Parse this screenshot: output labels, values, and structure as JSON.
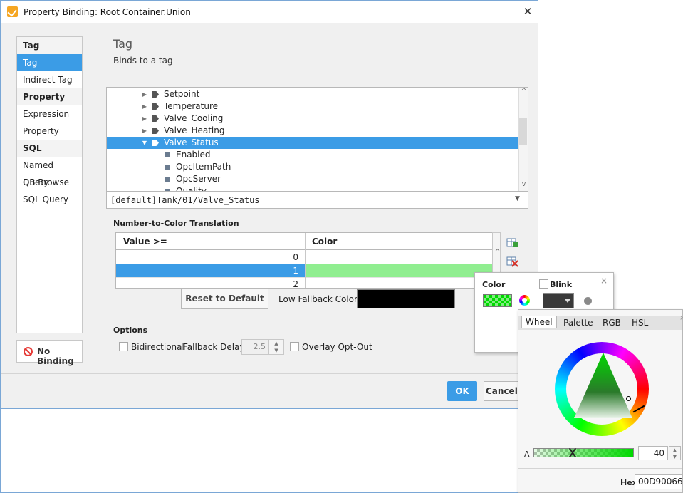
{
  "window": {
    "title": "Property Binding: Root Container.Union",
    "close": "✕"
  },
  "sidebar": {
    "items": [
      {
        "label": "Tag",
        "type": "header"
      },
      {
        "label": "Tag",
        "type": "selected"
      },
      {
        "label": "Indirect Tag",
        "type": "item"
      },
      {
        "label": "Property",
        "type": "header"
      },
      {
        "label": "Expression",
        "type": "item"
      },
      {
        "label": "Property",
        "type": "item"
      },
      {
        "label": "SQL",
        "type": "header"
      },
      {
        "label": "Named Query",
        "type": "item"
      },
      {
        "label": "DB Browse",
        "type": "item"
      },
      {
        "label": "SQL Query",
        "type": "item"
      }
    ],
    "no_binding_label": "No Binding"
  },
  "panel": {
    "title": "Tag",
    "description": "Binds to a tag"
  },
  "tree": {
    "rows": [
      {
        "label": "Setpoint",
        "kind": "folder",
        "arrow": "▶"
      },
      {
        "label": "Temperature",
        "kind": "folder",
        "arrow": "▶"
      },
      {
        "label": "Valve_Cooling",
        "kind": "folder",
        "arrow": "▶"
      },
      {
        "label": "Valve_Heating",
        "kind": "folder",
        "arrow": "▶"
      },
      {
        "label": "Valve_Status",
        "kind": "folder",
        "arrow": "▼",
        "selected": true
      },
      {
        "label": "Enabled",
        "kind": "leaf"
      },
      {
        "label": "OpcItemPath",
        "kind": "leaf"
      },
      {
        "label": "OpcServer",
        "kind": "leaf"
      },
      {
        "label": "Quality",
        "kind": "leaf"
      }
    ],
    "path": "[default]Tank/01/Valve_Status"
  },
  "translation": {
    "title": "Number-to-Color Translation",
    "col_value": "Value >=",
    "col_color": "Color",
    "rows": [
      {
        "value": "0",
        "color": "#ffffff"
      },
      {
        "value": "1",
        "color": "#90ee90",
        "selected": true
      },
      {
        "value": "2",
        "color": "#ffffff"
      }
    ],
    "reset_label": "Reset to Default",
    "low_fallback_label": "Low Fallback Color:",
    "low_fallback_color": "#000000"
  },
  "options": {
    "title": "Options",
    "bidirectional": "Bidirectional",
    "fallback_delay_label": "Fallback Delay",
    "fallback_delay_value": "2.5",
    "overlay_opt_out": "Overlay Opt-Out"
  },
  "footer": {
    "ok": "OK",
    "cancel": "Cancel"
  },
  "color_popup": {
    "color_label": "Color",
    "blink_label": "Blink",
    "close": "×"
  },
  "chooser": {
    "tabs": [
      "Wheel",
      "Palette",
      "RGB",
      "HSL"
    ],
    "alpha_label": "A",
    "alpha_value": "40",
    "hex_label": "Hex",
    "hex_value": "00D90066",
    "close": "×"
  },
  "colors": {
    "accent": "#3b9ce6",
    "green": "#00d900",
    "danger": "#e53935"
  }
}
